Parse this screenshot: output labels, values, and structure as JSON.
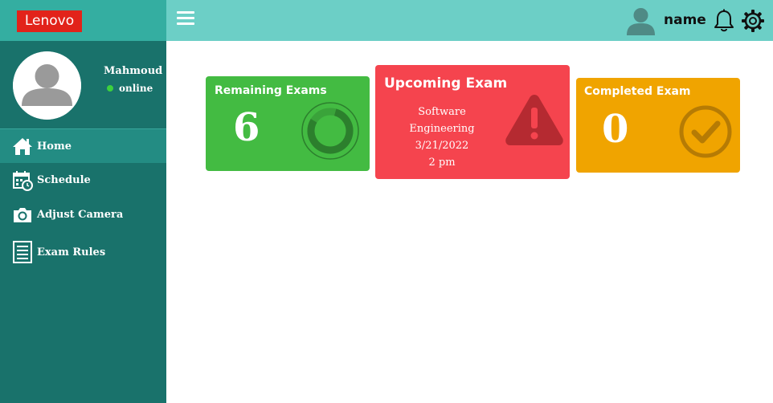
{
  "brand": {
    "logo_text": "Lenovo",
    "color": "#e2231a"
  },
  "user": {
    "name": "Mahmoud",
    "status": "online"
  },
  "sidebar": {
    "items": [
      {
        "label": "Home",
        "icon": "home-icon",
        "active": true
      },
      {
        "label": "Schedule",
        "icon": "calendar-clock-icon",
        "active": false
      },
      {
        "label": "Adjust Camera",
        "icon": "camera-icon",
        "active": false
      },
      {
        "label": "Exam Rules",
        "icon": "document-icon",
        "active": false
      }
    ]
  },
  "header": {
    "username": "name",
    "icons": [
      "menu-icon",
      "user-avatar-icon",
      "bell-icon",
      "gear-icon"
    ]
  },
  "cards": {
    "remaining": {
      "title": "Remaining Exams",
      "value": "6",
      "icon": "progress-ring-icon",
      "color": "#43bb42"
    },
    "upcoming": {
      "title": "Upcoming Exam",
      "subject": "Software Engineering",
      "date": "3/21/2022",
      "time": "2 pm",
      "icon": "warning-icon",
      "color": "#f5444e"
    },
    "completed": {
      "title": "Completed Exam",
      "value": "0",
      "icon": "check-circle-icon",
      "color": "#f0a400"
    }
  },
  "colors": {
    "sidebar": "#19726b",
    "header": "#6ccfc6",
    "sidebar_top": "#34aea1",
    "active_item": "#238c83"
  }
}
